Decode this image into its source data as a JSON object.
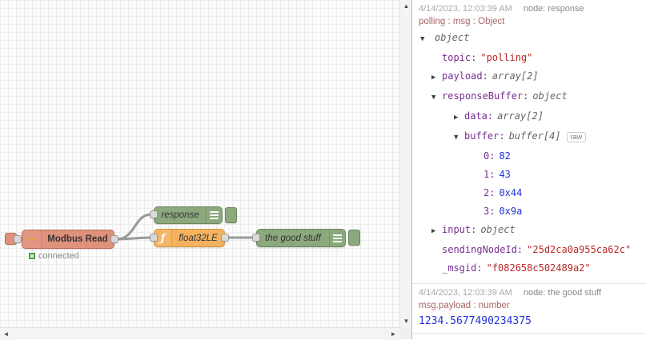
{
  "canvas": {
    "nodes": {
      "modbus": {
        "label": "Modbus Read",
        "icon": "✳",
        "status": "connected"
      },
      "response": {
        "label": "response"
      },
      "func": {
        "label": "float32LE",
        "icon": "ƒ"
      },
      "good": {
        "label": "the good stuff"
      }
    }
  },
  "scrollbars": {
    "up": "▲",
    "down": "▼",
    "left": "◄",
    "right": "►"
  },
  "debug": {
    "messages": [
      {
        "timestamp": "4/14/2023, 12:03:39 AM",
        "node": "node: response",
        "meta": "polling : msg : Object",
        "tree": [
          {
            "arrow": "▼",
            "key": "",
            "value": "object"
          },
          {
            "arrow": "",
            "key": "topic:",
            "value": "\"polling\""
          },
          {
            "arrow": "▶",
            "key": "payload:",
            "value": "array[2]"
          },
          {
            "arrow": "▼",
            "key": "responseBuffer:",
            "value": "object"
          },
          {
            "arrow": "▶",
            "key": "data:",
            "value": "array[2]"
          },
          {
            "arrow": "▼",
            "key": "buffer:",
            "value": "buffer[4]",
            "raw": "raw"
          },
          {
            "arrow": "",
            "key": "0:",
            "value": "82"
          },
          {
            "arrow": "",
            "key": "1:",
            "value": "43"
          },
          {
            "arrow": "",
            "key": "2:",
            "value": "0x44"
          },
          {
            "arrow": "",
            "key": "3:",
            "value": "0x9a"
          },
          {
            "arrow": "▶",
            "key": "input:",
            "value": "object"
          },
          {
            "arrow": "",
            "key": "sendingNodeId:",
            "value": "\"25d2ca0a955ca62c\""
          },
          {
            "arrow": "",
            "key": "_msgid:",
            "value": "\"f082658c502489a2\""
          }
        ]
      },
      {
        "timestamp": "4/14/2023, 12:03:39 AM",
        "node": "node: the good stuff",
        "meta": "msg.payload : number",
        "payload": "1234.5677490234375"
      }
    ]
  }
}
